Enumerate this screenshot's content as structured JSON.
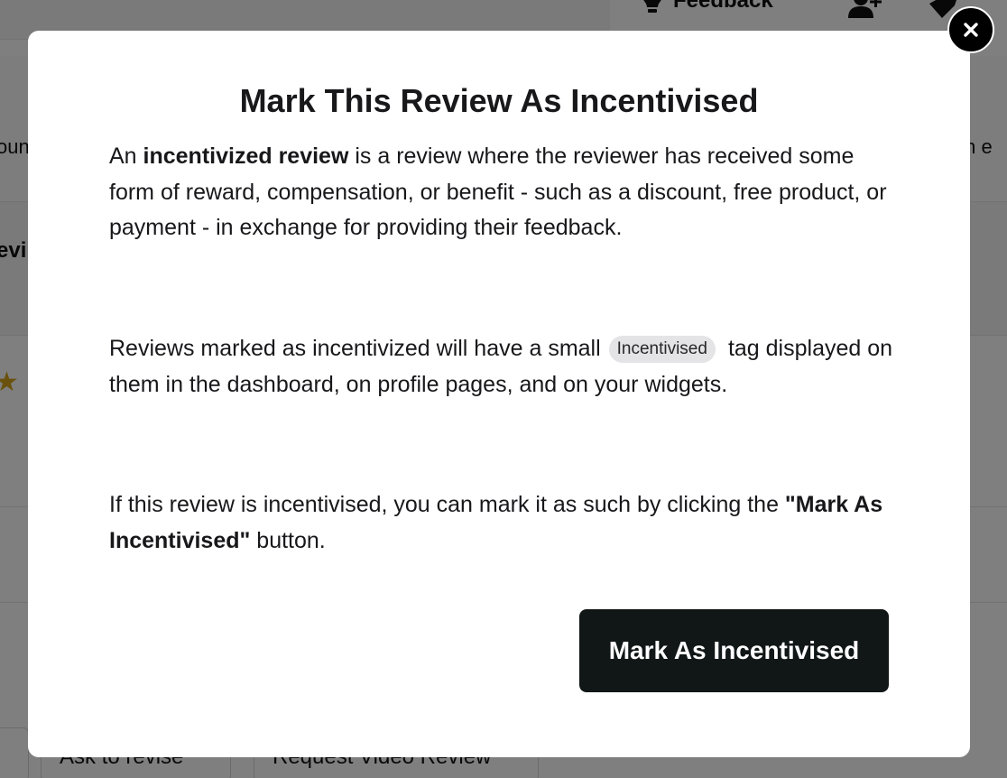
{
  "background": {
    "feedback_label": "Feedback",
    "left_fragment_1": "oun",
    "left_fragment_2": "evi",
    "right_fragment": "ion e",
    "star_glyph": "★",
    "button_ask_revise": "Ask to revise",
    "button_request_video": "Request Video Review"
  },
  "modal": {
    "title": "Mark This Review As Incentivised",
    "para1_prefix": "An ",
    "para1_bold": "incentivized review",
    "para1_suffix": " is a review where the reviewer has received some form of reward, compensation, or benefit - such as a discount, free product, or payment - in exchange for providing their feedback.",
    "para2_prefix": "Reviews marked as incentivized will have a small ",
    "tag_label": "Incentivised",
    "para2_suffix": "tag displayed on them in the dashboard, on profile pages, and on your widgets.",
    "para3_prefix": "If this review is incentivised, you can mark it as such by clicking the ",
    "para3_bold": "\"Mark As Incentivised\"",
    "para3_suffix": " button.",
    "primary_button": "Mark As Incentivised",
    "close_icon": "close-icon"
  },
  "colors": {
    "primary_button_bg": "#111716",
    "tag_bg": "#e4e4e7",
    "star": "#d4a21b"
  }
}
